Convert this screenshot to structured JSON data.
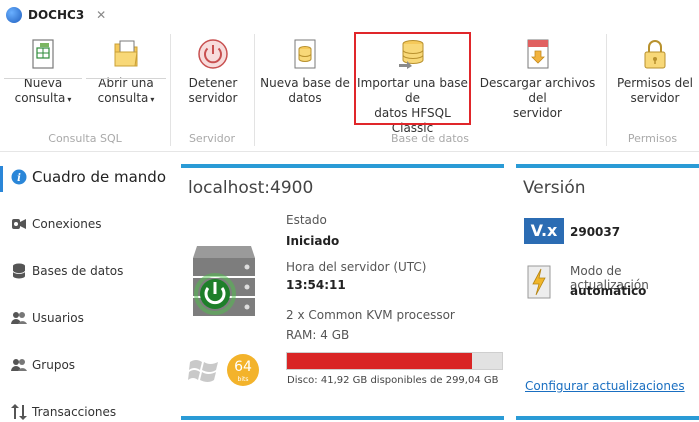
{
  "tab": {
    "title": "DOCHC3",
    "close": "✕"
  },
  "ribbon": {
    "groups": {
      "sql": "Consulta SQL",
      "server": "Servidor",
      "db": "Base de datos",
      "perms": "Permisos"
    },
    "buttons": {
      "new_query": "Nueva\nconsulta",
      "open_query": "Abrir una\nconsulta",
      "stop_server": "Detener\nservidor",
      "new_db": "Nueva base de\ndatos",
      "import_db": "Importar una base de\ndatos HFSQL Classic",
      "download_files": "Descargar archivos del\nservidor",
      "server_perms": "Permisos del\nservidor"
    },
    "caret": "▾"
  },
  "sidebar": {
    "items": [
      {
        "label": "Cuadro de mando",
        "icon": "info-icon"
      },
      {
        "label": "Conexiones",
        "icon": "connections-icon"
      },
      {
        "label": "Bases de datos",
        "icon": "database-icon"
      },
      {
        "label": "Usuarios",
        "icon": "users-icon"
      },
      {
        "label": "Grupos",
        "icon": "groups-icon"
      },
      {
        "label": "Transacciones",
        "icon": "transactions-icon"
      }
    ]
  },
  "server_panel": {
    "title": "localhost:4900",
    "state_label": "Estado",
    "state_value": "Iniciado",
    "time_label": "Hora del servidor (UTC)",
    "time_value": "13:54:11",
    "cpu": "2 x Common KVM processor",
    "ram": "RAM: 4 GB",
    "arch_badge": "64",
    "arch_sub": "bits",
    "disk_used_fraction": 0.86,
    "disk_text": "Disco: 41,92 GB disponibles de 299,04 GB",
    "accent": "#2a9bd6",
    "disk_color": "#d92525"
  },
  "version_panel": {
    "title": "Versión",
    "logo": "V.x",
    "version": "290037",
    "update_label": "Modo de actualización",
    "update_value": "automático",
    "configure_link": "Configurar actualizaciones"
  }
}
